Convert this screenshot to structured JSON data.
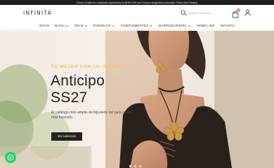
{
  "topbar": {
    "message": "Envío Gratis en compras superiores a $150.000 con Correo Argentino (excepto Tierra del Fuego)"
  },
  "header": {
    "logo": "INFINITA",
    "search_placeholder": "Buscar productos...",
    "cart_count": "0"
  },
  "nav": {
    "items": [
      {
        "label": "INICIO",
        "dropdown": false
      },
      {
        "label": "BIJOU",
        "dropdown": true
      },
      {
        "label": "PELO",
        "dropdown": true
      },
      {
        "label": "PAÑUELOS",
        "dropdown": true
      },
      {
        "label": "COMPLEMENTOS",
        "dropdown": true
      },
      {
        "label": "MARROQUINERÍA",
        "dropdown": true
      },
      {
        "label": "HOME LINE",
        "dropdown": false
      },
      {
        "label": "INFANTIL",
        "dropdown": false
      }
    ]
  },
  "hero": {
    "eyebrow": "TU MEJOR CON LO ÚLTIMO",
    "title_line1": "Anticipo",
    "title_line2": "SS27",
    "description": "El catálogo más amplio de bijouterie del país con lo más buscado.",
    "cta_label": "Ver colección",
    "slides_total": 3,
    "slide_active": 1
  },
  "colors": {
    "accent": "#f2c463",
    "topbar_bg": "#1e1e1e",
    "button_bg": "#222222",
    "whatsapp": "#25d366",
    "badge": "#e07a6d"
  }
}
